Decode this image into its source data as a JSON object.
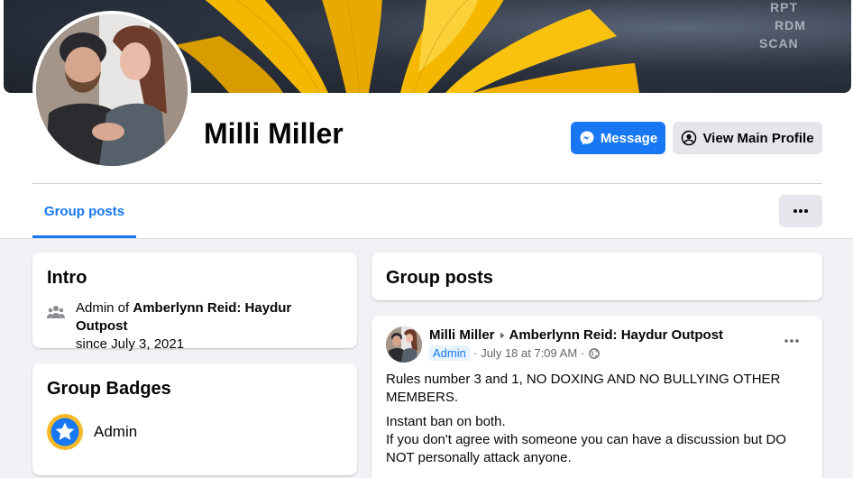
{
  "profile": {
    "name": "Milli Miller"
  },
  "cover": {
    "labels": [
      "RPT",
      "RDM",
      "SCAN"
    ]
  },
  "buttons": {
    "message": "Message",
    "view_main_profile": "View Main Profile"
  },
  "tabs": {
    "group_posts": "Group posts"
  },
  "intro": {
    "title": "Intro",
    "admin_prefix": "Admin of",
    "group_name": "Amberlynn Reid: Haydur Outpost",
    "since": "since July 3, 2021"
  },
  "badges": {
    "title": "Group Badges",
    "items": [
      {
        "label": "Admin",
        "icon": "star-badge-icon",
        "color": "#f7b928"
      }
    ]
  },
  "group_posts": {
    "title": "Group posts"
  },
  "post": {
    "author": "Milli Miller",
    "group": "Amberlynn Reid: Haydur Outpost",
    "role_badge": "Admin",
    "timestamp": "July 18 at 7:09 AM",
    "separator": "·",
    "audience_icon": "globe-icon",
    "paragraphs": [
      "Rules number 3 and 1, NO DOXING AND NO BULLYING OTHER MEMBERS.",
      "Instant ban on both.",
      "If you don't agree with someone you can have a discussion but DO NOT personally attack anyone."
    ]
  },
  "colors": {
    "accent": "#1877f2",
    "page_bg": "#f0f2f5",
    "secondary_text": "#65676b"
  }
}
